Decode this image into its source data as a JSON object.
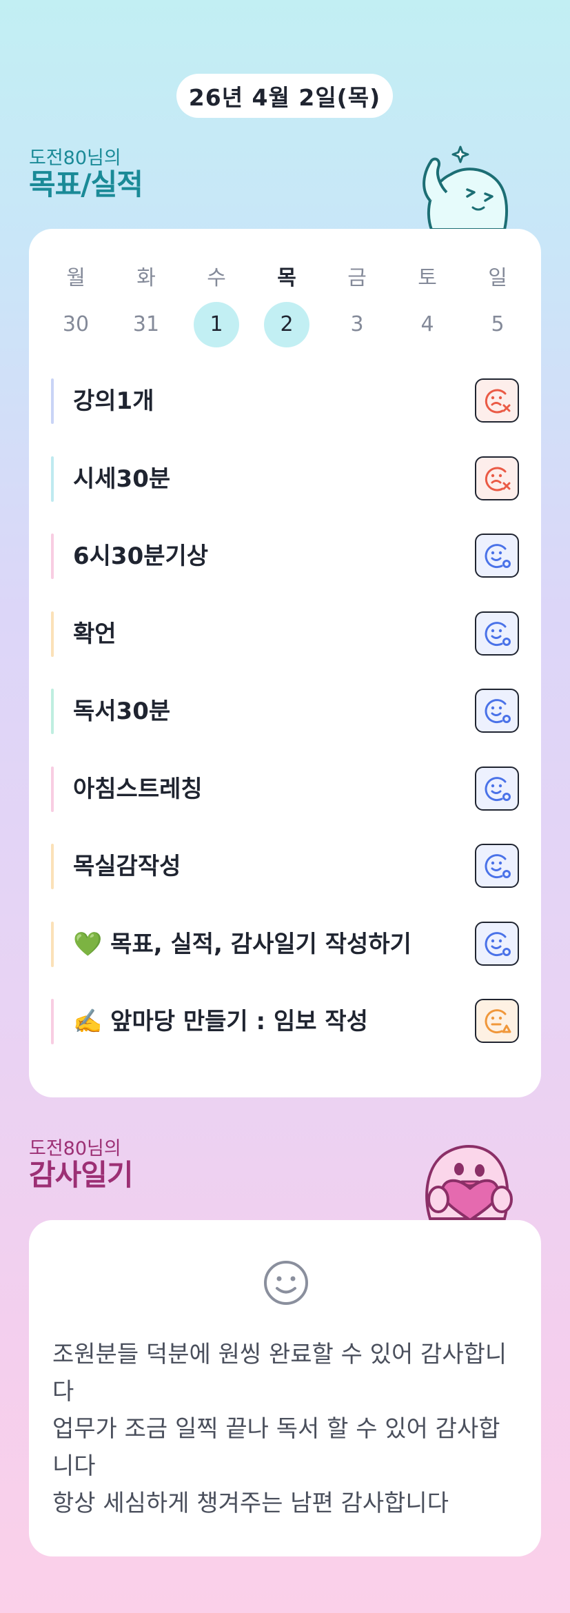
{
  "header": {
    "date": "26년 4월 2일(목)"
  },
  "goals_section": {
    "owner": "도전80님의",
    "title": "목표/실적"
  },
  "week": {
    "days": [
      {
        "name": "월",
        "date": "30",
        "highlight": false,
        "today": false
      },
      {
        "name": "화",
        "date": "31",
        "highlight": false,
        "today": false
      },
      {
        "name": "수",
        "date": "1",
        "highlight": true,
        "today": false
      },
      {
        "name": "목",
        "date": "2",
        "highlight": true,
        "today": true
      },
      {
        "name": "금",
        "date": "3",
        "highlight": false,
        "today": false
      },
      {
        "name": "토",
        "date": "4",
        "highlight": false,
        "today": false
      },
      {
        "name": "일",
        "date": "5",
        "highlight": false,
        "today": false
      }
    ]
  },
  "tasks": [
    {
      "label": "강의1개",
      "status": "fail",
      "bar_color": "#c9d4f6"
    },
    {
      "label": "시세30분",
      "status": "fail",
      "bar_color": "#bfeaf0"
    },
    {
      "label": "6시30분기상",
      "status": "done",
      "bar_color": "#f8cde2"
    },
    {
      "label": "확언",
      "status": "done",
      "bar_color": "#fbe1b8"
    },
    {
      "label": "독서30분",
      "status": "done",
      "bar_color": "#bfeee0"
    },
    {
      "label": "아침스트레칭",
      "status": "done",
      "bar_color": "#f8cde2"
    },
    {
      "label": "목실감작성",
      "status": "done",
      "bar_color": "#fbe1b8"
    },
    {
      "label": "💚 목표, 실적, 감사일기 작성하기",
      "status": "done",
      "bar_color": "#fbe1b8"
    },
    {
      "label": "✍️ 앞마당 만들기 : 임보 작성",
      "status": "partial",
      "bar_color": "#f8cde2"
    }
  ],
  "status_colors": {
    "fail": "#ea5a45",
    "done": "#4a72e8",
    "partial": "#f0973a"
  },
  "gratitude_section": {
    "owner": "도전80님의",
    "title": "감사일기",
    "lines": [
      "조원분들 덕분에 원씽 완료할 수 있어 감사합니다",
      "업무가 조금 일찍 끝나 독서 할 수 있어 감사합니다",
      "항상 세심하게 챙겨주는 남편 감사합니다"
    ]
  }
}
